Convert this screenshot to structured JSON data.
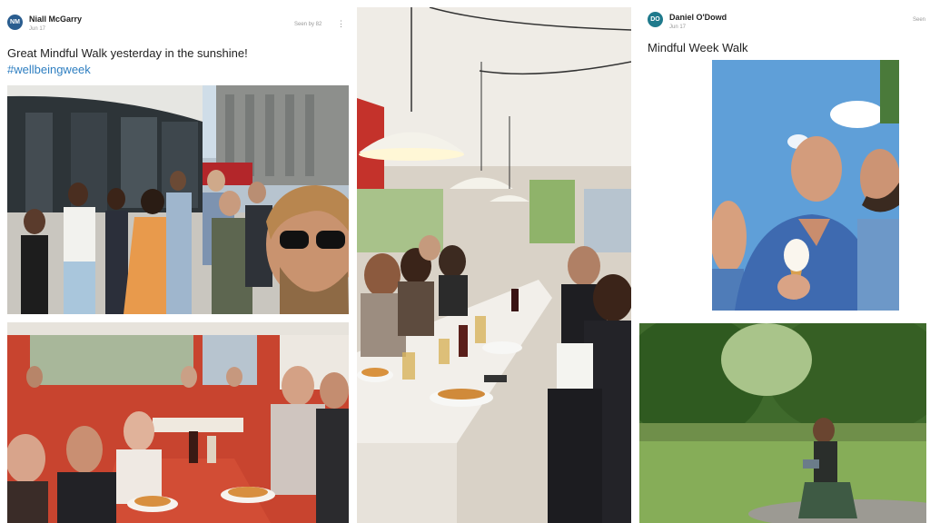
{
  "posts": [
    {
      "author": "Niall McGarry",
      "initials": "NM",
      "avatar_color": "#2a5d8f",
      "date": "Jun 17",
      "seen": "Seen by 82",
      "more_icon": "more-vertical-icon",
      "text": "Great Mindful Walk yesterday in the sunshine!",
      "hashtag": "#wellbeingweek",
      "hashtag_color": "#2f7fc1"
    },
    {
      "author": "Daniel O'Dowd",
      "initials": "DO",
      "avatar_color": "#1f7a8c",
      "date": "Jun 17",
      "seen": "Seen",
      "text": "Mindful Week Walk"
    }
  ]
}
